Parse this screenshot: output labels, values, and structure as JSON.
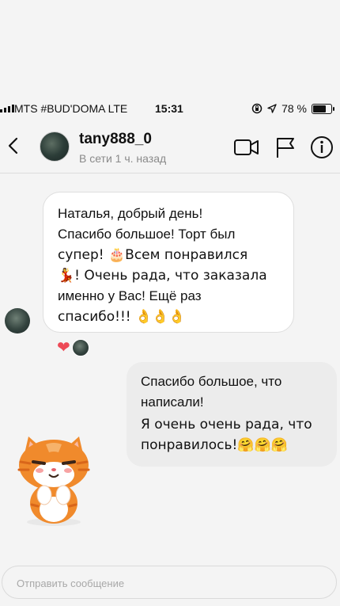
{
  "status_bar": {
    "carrier": "MTS #BUD'DOMA  LTE",
    "time": "15:31",
    "battery_text": "78 %",
    "battery_level": 0.78
  },
  "header": {
    "username": "tany888_0",
    "status": "В сети 1 ч. назад"
  },
  "messages": {
    "incoming": {
      "lines": [
        "Наталья, добрый день!",
        "Спасибо большое! Торт был",
        "супер! 🎂Всем  понравился",
        "💃! Очень рада, что заказала",
        "именно у Вас! Ещё раз",
        "спасибо!!! 👌👌👌"
      ],
      "reaction": "❤"
    },
    "outgoing": {
      "paragraph1": "Спасибо большое, что написали!",
      "paragraph2": "Я очень очень рада, что понравилось!🤗🤗🤗"
    }
  },
  "compose": {
    "placeholder": "Отправить сообщение"
  },
  "colors": {
    "background": "#f4f4f4",
    "incoming_bubble": "#ffffff",
    "outgoing_bubble": "#ececec",
    "heart": "#ed4956"
  }
}
